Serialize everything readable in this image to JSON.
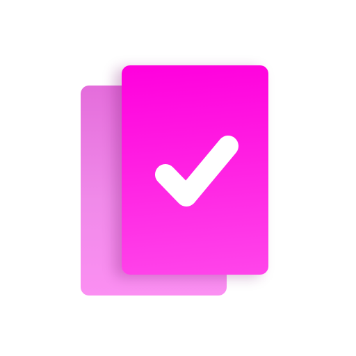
{
  "icon": {
    "name": "task-cards-check-icon",
    "colors": {
      "front_card_top": "#ff00dd",
      "front_card_bottom": "#ff45ea",
      "back_card_top": "#e46ddb",
      "back_card_bottom": "#fb8ff2",
      "check_mark": "#ffffff",
      "background": "#ffffff"
    },
    "parts": [
      "back-card",
      "front-card",
      "check-mark-icon"
    ]
  }
}
